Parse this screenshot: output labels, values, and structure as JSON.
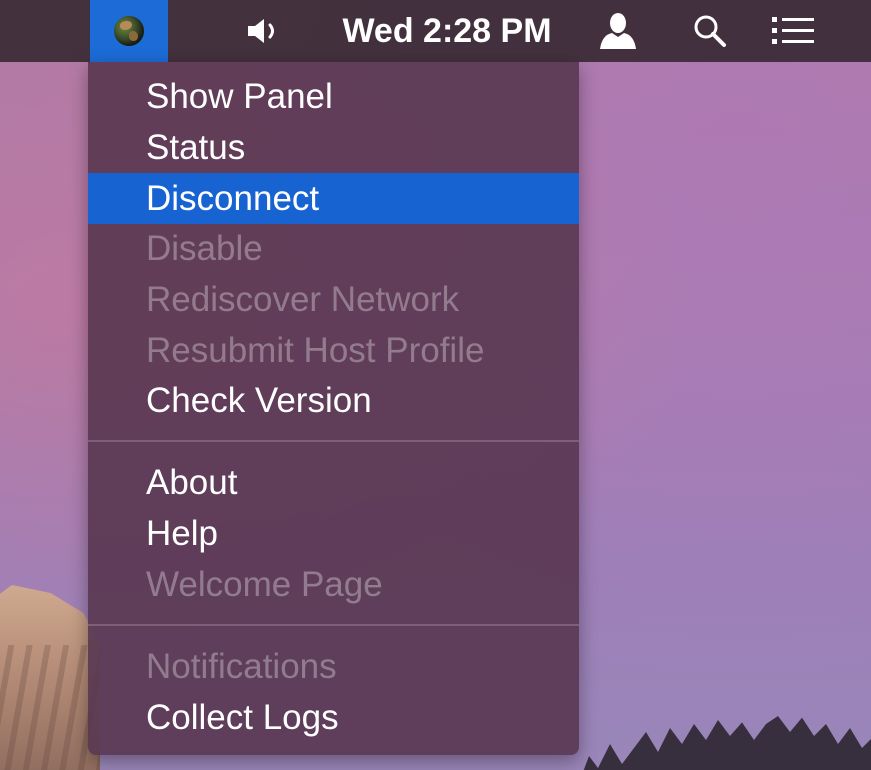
{
  "menubar": {
    "app_icon": "globe-icon",
    "volume_icon": "speaker-icon",
    "clock": "Wed 2:28 PM",
    "user_icon": "user-icon",
    "search_icon": "search-icon",
    "list_icon": "list-icon"
  },
  "menu": {
    "items": [
      {
        "label": "Show Panel",
        "enabled": true
      },
      {
        "label": "Status",
        "enabled": true
      },
      {
        "label": "Disconnect",
        "enabled": true,
        "highlighted": true
      },
      {
        "label": "Disable",
        "enabled": false
      },
      {
        "label": "Rediscover Network",
        "enabled": false
      },
      {
        "label": "Resubmit Host Profile",
        "enabled": false
      },
      {
        "label": "Check Version",
        "enabled": true
      },
      {
        "label": "About",
        "enabled": true
      },
      {
        "label": "Help",
        "enabled": true
      },
      {
        "label": "Welcome Page",
        "enabled": false
      },
      {
        "label": "Notifications",
        "enabled": false
      },
      {
        "label": "Collect Logs",
        "enabled": true
      }
    ]
  },
  "colors": {
    "highlight": "#1763d2",
    "app_icon_bg": "#1c6bd6",
    "menu_bg": "#583650"
  }
}
